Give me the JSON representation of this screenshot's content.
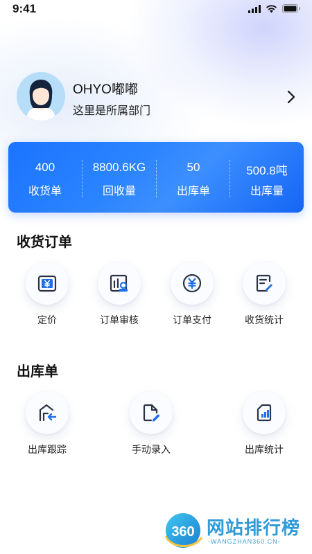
{
  "status_bar": {
    "time": "9:41"
  },
  "profile": {
    "name": "OHYO嘟嘟",
    "department": "这里是所属部门"
  },
  "stats": [
    {
      "value": "400",
      "label": "收货单"
    },
    {
      "value": "8800.6KG",
      "label": "回收量"
    },
    {
      "value": "50",
      "label": "出库单"
    },
    {
      "value": "500.8吨",
      "label": "出库量"
    }
  ],
  "receipt_section": {
    "title": "收货订单",
    "items": [
      {
        "label": "定价",
        "icon": "yuan-wallet-icon"
      },
      {
        "label": "订单审核",
        "icon": "audit-chart-icon"
      },
      {
        "label": "订单支付",
        "icon": "yuan-circle-icon"
      },
      {
        "label": "收货统计",
        "icon": "edit-document-icon"
      }
    ]
  },
  "outbound_section": {
    "title": "出库单",
    "items": [
      {
        "label": "出库跟踪",
        "icon": "warehouse-return-icon"
      },
      {
        "label": "手动录入",
        "icon": "document-edit-icon"
      },
      {
        "label": "出库统计",
        "icon": "bar-chart-document-icon"
      }
    ]
  },
  "watermark": {
    "logo_text": "360",
    "title": "网站排行榜",
    "subtitle": "-WANGZHAN360.CN-"
  },
  "colors": {
    "accent": "#1b74ff",
    "icon_blue": "#1f6fe8",
    "icon_dark": "#2a3346"
  }
}
